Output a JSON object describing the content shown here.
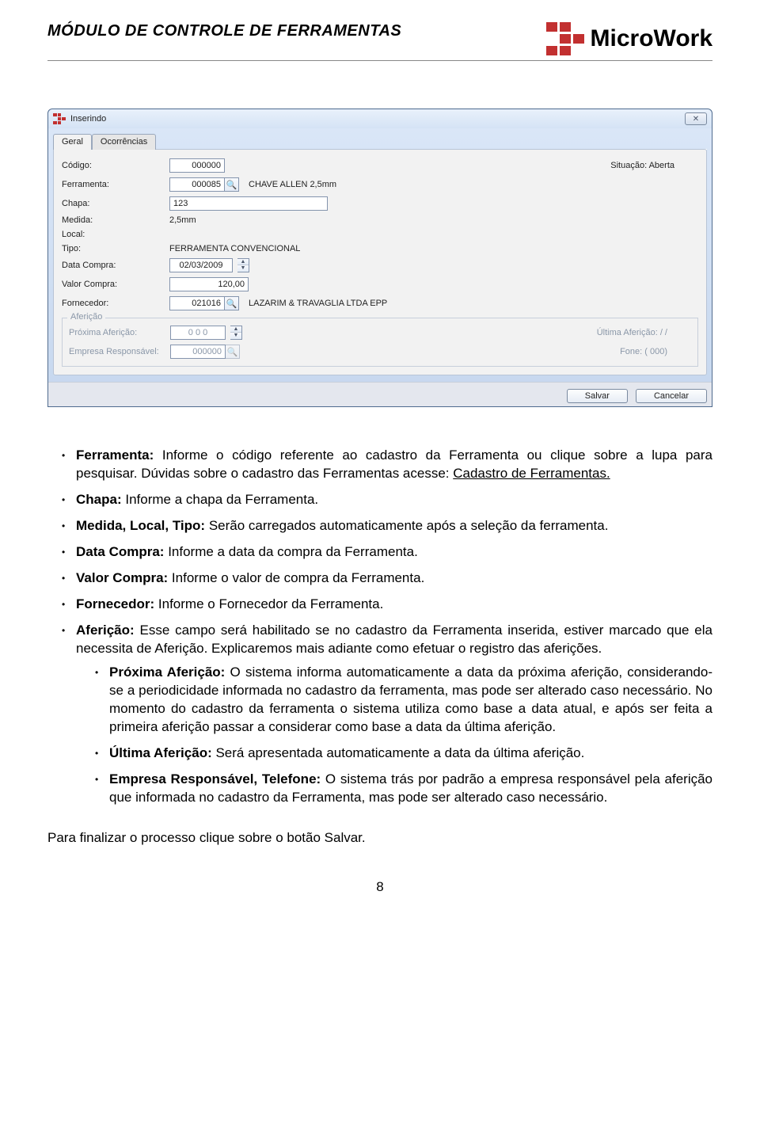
{
  "doc": {
    "title": "MÓDULO DE CONTROLE DE FERRAMENTAS",
    "brand": "MicroWork",
    "page_number": "8",
    "final_line": "Para finalizar o processo clique sobre o botão Salvar."
  },
  "win": {
    "title": "Inserindo",
    "close_label": "✕",
    "tabs": {
      "geral": "Geral",
      "ocorrencias": "Ocorrências"
    },
    "buttons": {
      "salvar": "Salvar",
      "cancelar": "Cancelar"
    },
    "labels": {
      "codigo": "Código:",
      "ferramenta": "Ferramenta:",
      "chapa": "Chapa:",
      "medida": "Medida:",
      "local": "Local:",
      "tipo": "Tipo:",
      "data_compra": "Data Compra:",
      "valor_compra": "Valor Compra:",
      "fornecedor": "Fornecedor:",
      "afericao_legend": "Aferição",
      "prox_afericao": "Próxima Aferição:",
      "empresa_resp": "Empresa Responsável:",
      "situacao": "Situação: Aberta",
      "ultima_afericao": "Última Aferição:   /  /",
      "fone": "Fone: ( 000)"
    },
    "values": {
      "codigo": "000000",
      "ferramenta_code": "000085",
      "ferramenta_desc": "CHAVE ALLEN 2,5mm",
      "chapa": "123",
      "medida": "2,5mm",
      "local": "",
      "tipo": "FERRAMENTA CONVENCIONAL",
      "data_compra": "02/03/2009",
      "valor_compra": "120,00",
      "fornecedor_code": "021016",
      "fornecedor_desc": "LAZARIM & TRAVAGLIA LTDA EPP",
      "prox_afericao": "0 0  0",
      "empresa_resp": "000000"
    }
  },
  "instr": {
    "items": [
      {
        "head": "Ferramenta:",
        "body": " Informe o código referente ao cadastro da Ferramenta ou clique sobre a lupa para pesquisar. Dúvidas sobre o cadastro das Ferramentas acesse: ",
        "link": "Cadastro de Ferramentas.",
        "tail": ""
      },
      {
        "head": "Chapa:",
        "body": " Informe a chapa da Ferramenta."
      },
      {
        "head": "Medida, Local, Tipo:",
        "body": " Serão carregados automaticamente após a seleção da ferramenta."
      },
      {
        "head": "Data Compra:",
        "body": " Informe a data da compra da Ferramenta."
      },
      {
        "head": "Valor Compra:",
        "body": " Informe o valor de compra da Ferramenta."
      },
      {
        "head": "Fornecedor:",
        "body": " Informe o Fornecedor da Ferramenta."
      },
      {
        "head": "Aferição:",
        "body": " Esse campo será habilitado se no cadastro da Ferramenta inserida, estiver marcado que ela necessita de Aferição. Explicaremos mais adiante como efetuar o registro das aferições."
      }
    ],
    "sub": [
      {
        "head": "Próxima Aferição:",
        "body": " O sistema informa automaticamente a data  da próxima aferição, considerando-se a periodicidade informada no cadastro da ferramenta, mas pode ser alterado caso necessário. No momento do cadastro da ferramenta o sistema utiliza como base a data atual, e após ser feita a primeira aferição passar a considerar como base a data da última aferição."
      },
      {
        "head": "Última Aferição:",
        "body": " Será apresentada automaticamente a data da última aferição."
      },
      {
        "head": "Empresa Responsável, Telefone:",
        "body": " O sistema trás por padrão a empresa responsável pela aferição que informada no cadastro da Ferramenta, mas pode ser alterado caso necessário."
      }
    ]
  }
}
